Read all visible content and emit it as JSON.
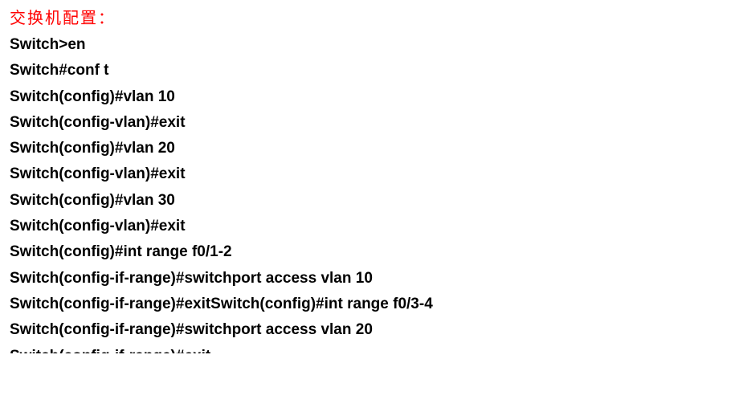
{
  "title": "交换机配置：",
  "lines": [
    "Switch>en",
    "Switch#conf t",
    "Switch(config)#vlan 10",
    "Switch(config-vlan)#exit",
    "Switch(config)#vlan 20",
    "Switch(config-vlan)#exit",
    "Switch(config)#vlan 30",
    "Switch(config-vlan)#exit",
    "Switch(config)#int range f0/1-2",
    "Switch(config-if-range)#switchport access vlan 10",
    "Switch(config-if-range)#exitSwitch(config)#int range f0/3-4",
    "Switch(config-if-range)#switchport access vlan 20",
    "Switch(config-if-range)#exit"
  ]
}
